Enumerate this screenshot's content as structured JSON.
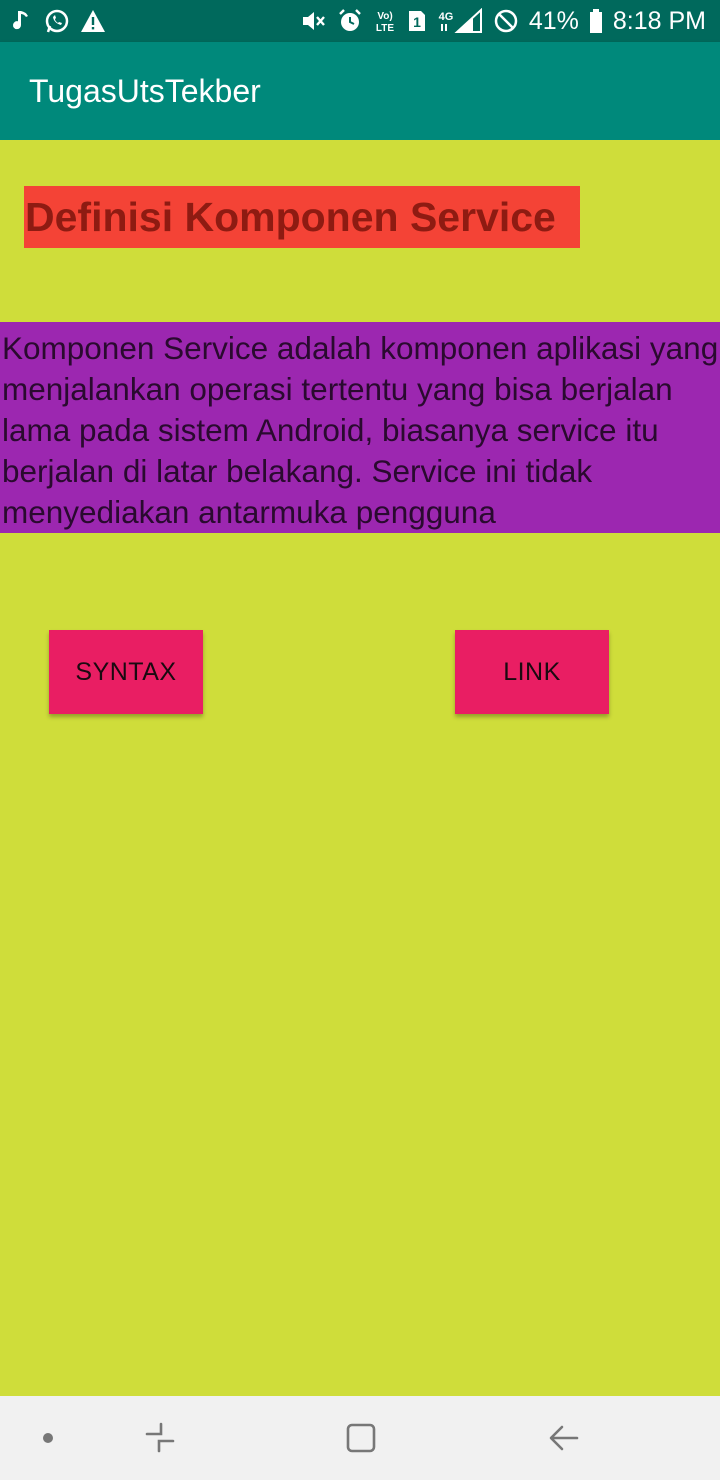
{
  "status_bar": {
    "left_icons": [
      "music-note-icon",
      "whatsapp-icon",
      "warning-icon"
    ],
    "right_icons": [
      "mute-icon",
      "alarm-icon",
      "volte-icon",
      "sim1-icon",
      "signal-4g-icon",
      "dnd-icon",
      "battery-icon"
    ],
    "volte_label": "Vo) LTE",
    "sim_label": "1",
    "network_label": "4G",
    "battery_percent": "41%",
    "time": "8:18 PM"
  },
  "app_bar": {
    "title": "TugasUtsTekber"
  },
  "content": {
    "heading": "Definisi Komponen Service",
    "description": "Komponen Service adalah komponen aplikasi yang menjalankan operasi tertentu yang bisa berjalan lama pada sistem Android, biasanya service itu berjalan di latar belakang. Service ini tidak menyediakan antarmuka pengguna",
    "buttons": {
      "syntax": "SYNTAX",
      "link": "LINK"
    }
  },
  "colors": {
    "status_bar": "#00695c",
    "app_bar": "#00897b",
    "background": "#cfdd3a",
    "heading_bg": "#f44336",
    "description_bg": "#9c27b0",
    "button_bg": "#e91e63",
    "nav_bar": "#f1f1f1"
  },
  "nav_bar": {
    "items": [
      "menu-dot-icon",
      "recent-apps-icon",
      "home-icon",
      "back-icon"
    ]
  }
}
